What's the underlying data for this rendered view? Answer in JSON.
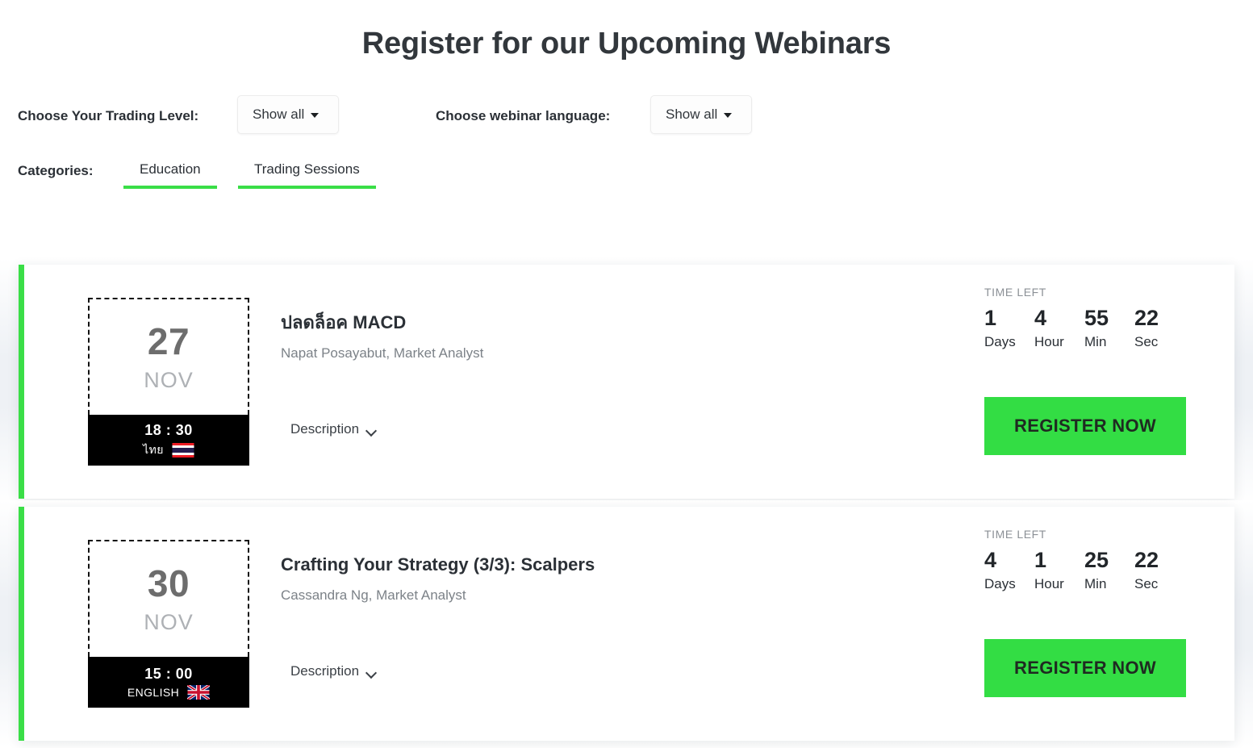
{
  "header": {
    "title": "Register for our Upcoming Webinars"
  },
  "filters": {
    "trading_level": {
      "label": "Choose Your Trading Level:",
      "value": "Show all"
    },
    "language": {
      "label": "Choose webinar language:",
      "value": "Show all"
    },
    "categories": {
      "label": "Categories:",
      "tabs": [
        {
          "label": "Education"
        },
        {
          "label": "Trading Sessions"
        }
      ]
    }
  },
  "common": {
    "time_left_label": "TIME LEFT",
    "description_label": "Description",
    "register_label": "REGISTER NOW",
    "unit_labels": {
      "days": "Days",
      "hour": "Hour",
      "min": "Min",
      "sec": "Sec"
    }
  },
  "colors": {
    "accent_green": "#33dd44",
    "tab_underline": "#3ade47",
    "card_bg": "#ffffff",
    "page_bg": "#ffffff",
    "gap_bg": "#eef1f5",
    "date_bar_bg": "#000000",
    "muted_text": "#7c8288"
  },
  "webinars": [
    {
      "day": "27",
      "month": "NOV",
      "time": "18 : 30",
      "language": "ไทย",
      "flag": "flag-thailand",
      "title": "ปลดล็อค MACD",
      "speaker": "Napat Posayabut, Market Analyst",
      "countdown": {
        "days": "1",
        "hour": "4",
        "min": "55",
        "sec": "22"
      }
    },
    {
      "day": "30",
      "month": "NOV",
      "time": "15 : 00",
      "language": "ENGLISH",
      "flag": "flag-uk",
      "title": "Crafting Your Strategy (3/3): Scalpers",
      "speaker": "Cassandra Ng, Market Analyst",
      "countdown": {
        "days": "4",
        "hour": "1",
        "min": "25",
        "sec": "22"
      }
    }
  ]
}
